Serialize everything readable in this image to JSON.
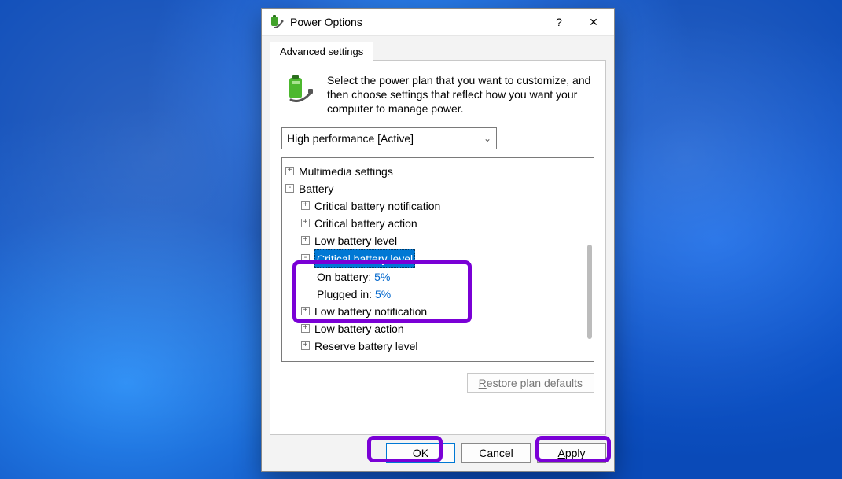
{
  "titlebar": {
    "title": "Power Options",
    "help": "?",
    "close": "✕"
  },
  "tabs": {
    "advanced": "Advanced settings"
  },
  "intro": "Select the power plan that you want to customize, and then choose settings that reflect how you want your computer to manage power.",
  "plan": {
    "selected": "High performance [Active]"
  },
  "tree": {
    "multimedia": "Multimedia settings",
    "battery": "Battery",
    "crit_notif": "Critical battery notification",
    "crit_action": "Critical battery action",
    "low_level": "Low battery level",
    "crit_level": "Critical battery level",
    "on_batt_label": "On battery:",
    "on_batt_value": "5%",
    "plugged_label": "Plugged in:",
    "plugged_value": "5%",
    "low_notif": "Low battery notification",
    "low_action": "Low battery action",
    "reserve": "Reserve battery level"
  },
  "restore": {
    "prefix": "R",
    "rest": "estore plan defaults"
  },
  "buttons": {
    "ok": "OK",
    "cancel": "Cancel",
    "apply_u": "A",
    "apply_rest": "pply"
  }
}
